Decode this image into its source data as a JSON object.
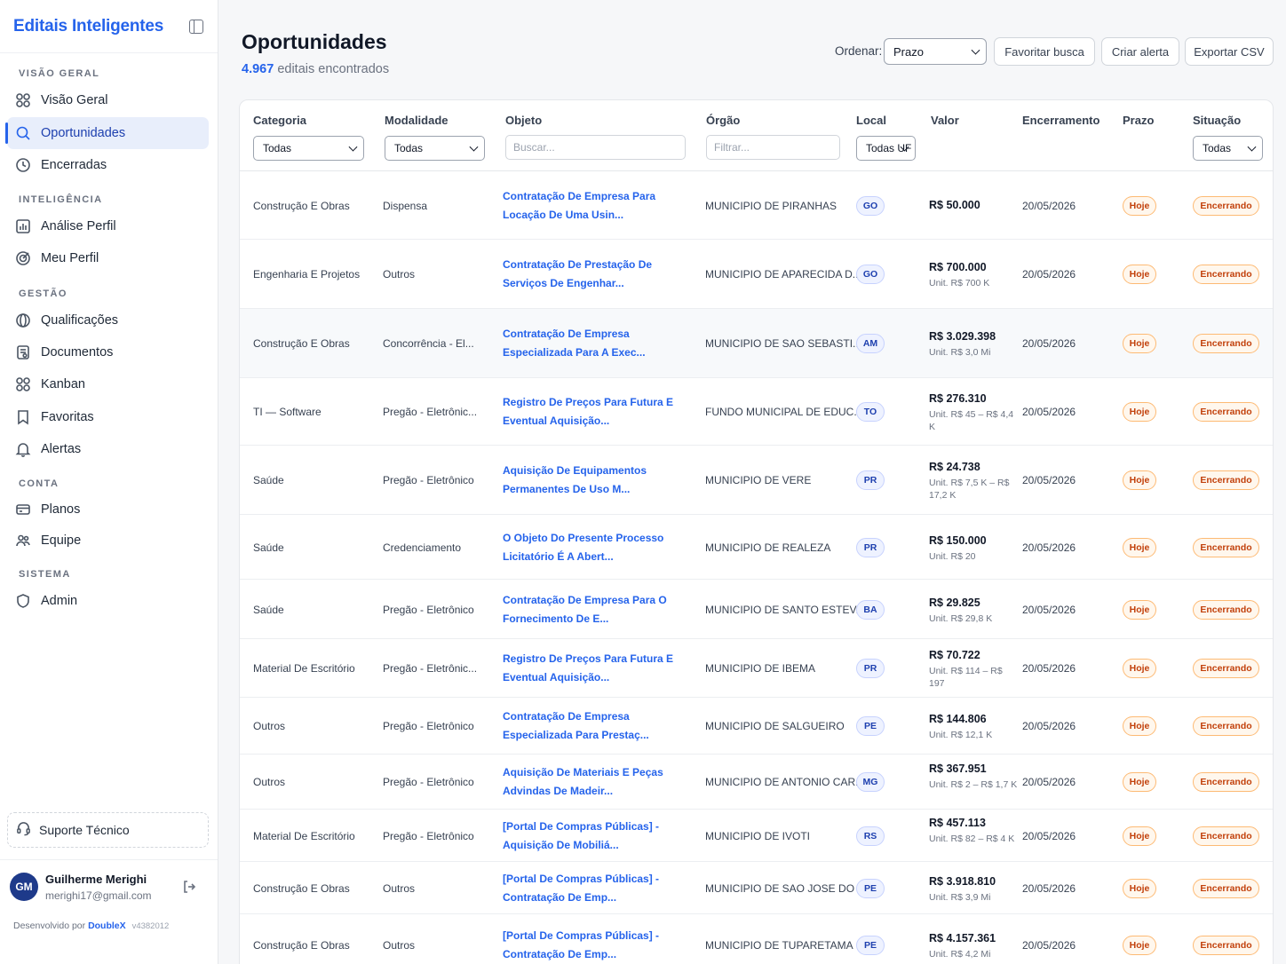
{
  "sidebar": {
    "brand": "Editais Inteligentes",
    "sections": {
      "visao_geral": "VISÃO GERAL",
      "inteligencia": "INTELIGÊNCIA",
      "gestao": "GESTÃO",
      "conta": "CONTA",
      "sistema": "SISTEMA"
    },
    "items": {
      "visao_geral": "Visão Geral",
      "oportunidades": "Oportunidades",
      "encerradas": "Encerradas",
      "analise_perfil": "Análise Perfil",
      "meu_perfil": "Meu Perfil",
      "qualificacoes": "Qualificações",
      "documentos": "Documentos",
      "kanban": "Kanban",
      "favoritas": "Favoritas",
      "alertas": "Alertas",
      "planos": "Planos",
      "equipe": "Equipe",
      "admin": "Admin"
    },
    "support": "Suporte Técnico",
    "user": {
      "initials": "GM",
      "name": "Guilherme Merighi",
      "email": "merighi17@gmail.com"
    },
    "footer": {
      "prefix": "Desenvolvido por",
      "brand": "DoubleX",
      "version": "v4382012"
    }
  },
  "header": {
    "title": "Oportunidades",
    "count": "4.967",
    "count_suffix": "editais encontrados",
    "order_label": "Ordenar:",
    "order_value": "Prazo",
    "buttons": {
      "favoritar": "Favoritar busca",
      "criar_alerta": "Criar alerta",
      "exportar": "Exportar CSV"
    }
  },
  "table": {
    "columns": [
      "Categoria",
      "Modalidade",
      "Objeto",
      "Órgão",
      "Local",
      "Valor",
      "Encerramento",
      "Prazo",
      "Situação"
    ],
    "filters": {
      "categoria": "Todas",
      "modalidade": "Todas",
      "objeto_placeholder": "Buscar...",
      "orgao_placeholder": "Filtrar...",
      "local": "Todas UF",
      "situacao": "Todas"
    },
    "rows": [
      {
        "categoria": "Construção E Obras",
        "modalidade": "Dispensa",
        "objeto": "Contratação De Empresa Para Locação De Uma Usin...",
        "orgao": "MUNICIPIO DE PIRANHAS",
        "uf": "GO",
        "valor": "R$ 50.000",
        "unit": "",
        "encerramento": "20/05/2026",
        "prazo": "Hoje",
        "situacao": "Encerrando"
      },
      {
        "categoria": "Engenharia E Projetos",
        "modalidade": "Outros",
        "objeto": "Contratação De Prestação De Serviços De Engenhar...",
        "orgao": "MUNICIPIO DE APARECIDA D...",
        "uf": "GO",
        "valor": "R$ 700.000",
        "unit": "Unit. R$ 700 K",
        "encerramento": "20/05/2026",
        "prazo": "Hoje",
        "situacao": "Encerrando"
      },
      {
        "categoria": "Construção E Obras",
        "modalidade": "Concorrência - El...",
        "objeto": "Contratação De Empresa Especializada Para A Exec...",
        "orgao": "MUNICIPIO DE SAO SEBASTI...",
        "uf": "AM",
        "valor": "R$ 3.029.398",
        "unit": "Unit. R$ 3,0 Mi",
        "encerramento": "20/05/2026",
        "prazo": "Hoje",
        "situacao": "Encerrando"
      },
      {
        "categoria": "TI — Software",
        "modalidade": "Pregão - Eletrônic...",
        "objeto": "Registro De Preços Para Futura E Eventual Aquisição...",
        "orgao": "FUNDO MUNICIPAL DE EDUC...",
        "uf": "TO",
        "valor": "R$ 276.310",
        "unit": "Unit. R$ 45 – R$ 4,4 K",
        "encerramento": "20/05/2026",
        "prazo": "Hoje",
        "situacao": "Encerrando"
      },
      {
        "categoria": "Saúde",
        "modalidade": "Pregão - Eletrônico",
        "objeto": "Aquisição De Equipamentos Permanentes De Uso M...",
        "orgao": "MUNICIPIO DE VERE",
        "uf": "PR",
        "valor": "R$ 24.738",
        "unit": "Unit. R$ 7,5 K – R$ 17,2 K",
        "encerramento": "20/05/2026",
        "prazo": "Hoje",
        "situacao": "Encerrando"
      },
      {
        "categoria": "Saúde",
        "modalidade": "Credenciamento",
        "objeto": "O Objeto Do Presente Processo Licitatório É A Abert...",
        "orgao": "MUNICIPIO DE REALEZA",
        "uf": "PR",
        "valor": "R$ 150.000",
        "unit": "Unit. R$ 20",
        "encerramento": "20/05/2026",
        "prazo": "Hoje",
        "situacao": "Encerrando"
      },
      {
        "categoria": "Saúde",
        "modalidade": "Pregão - Eletrônico",
        "objeto": "Contratação De Empresa Para O Fornecimento De E...",
        "orgao": "MUNICIPIO DE SANTO ESTEV...",
        "uf": "BA",
        "valor": "R$ 29.825",
        "unit": "Unit. R$ 29,8 K",
        "encerramento": "20/05/2026",
        "prazo": "Hoje",
        "situacao": "Encerrando"
      },
      {
        "categoria": "Material De Escritório",
        "modalidade": "Pregão - Eletrônic...",
        "objeto": "Registro De Preços Para Futura E Eventual Aquisição...",
        "orgao": "MUNICIPIO DE IBEMA",
        "uf": "PR",
        "valor": "R$ 70.722",
        "unit": "Unit. R$ 114 – R$ 197",
        "encerramento": "20/05/2026",
        "prazo": "Hoje",
        "situacao": "Encerrando"
      },
      {
        "categoria": "Outros",
        "modalidade": "Pregão - Eletrônico",
        "objeto": "Contratação De Empresa Especializada Para Prestaç...",
        "orgao": "MUNICIPIO DE SALGUEIRO",
        "uf": "PE",
        "valor": "R$ 144.806",
        "unit": "Unit. R$ 12,1 K",
        "encerramento": "20/05/2026",
        "prazo": "Hoje",
        "situacao": "Encerrando"
      },
      {
        "categoria": "Outros",
        "modalidade": "Pregão - Eletrônico",
        "objeto": "Aquisição De Materiais E Peças Advindas De Madeir...",
        "orgao": "MUNICIPIO DE ANTONIO CAR...",
        "uf": "MG",
        "valor": "R$ 367.951",
        "unit": "Unit. R$ 2 – R$ 1,7 K",
        "encerramento": "20/05/2026",
        "prazo": "Hoje",
        "situacao": "Encerrando"
      },
      {
        "categoria": "Material De Escritório",
        "modalidade": "Pregão - Eletrônico",
        "objeto": "[Portal De Compras Públicas] - Aquisição De Mobiliá...",
        "orgao": "MUNICIPIO DE IVOTI",
        "uf": "RS",
        "valor": "R$ 457.113",
        "unit": "Unit. R$ 82 – R$ 4 K",
        "encerramento": "20/05/2026",
        "prazo": "Hoje",
        "situacao": "Encerrando"
      },
      {
        "categoria": "Construção E Obras",
        "modalidade": "Outros",
        "objeto": "[Portal De Compras Públicas] - Contratação De Emp...",
        "orgao": "MUNICIPIO DE SAO JOSE DO ...",
        "uf": "PE",
        "valor": "R$ 3.918.810",
        "unit": "Unit. R$ 3,9 Mi",
        "encerramento": "20/05/2026",
        "prazo": "Hoje",
        "situacao": "Encerrando"
      },
      {
        "categoria": "Construção E Obras",
        "modalidade": "Outros",
        "objeto": "[Portal De Compras Públicas] - Contratação De Emp...",
        "orgao": "MUNICIPIO DE TUPARETAMA",
        "uf": "PE",
        "valor": "R$ 4.157.361",
        "unit": "Unit. R$ 4,2 Mi",
        "encerramento": "20/05/2026",
        "prazo": "Hoje",
        "situacao": "Encerrando"
      }
    ]
  },
  "colors": {
    "accent": "#2563eb",
    "badge_orange": "#c2410c",
    "badge_uf": "#1e40af"
  }
}
